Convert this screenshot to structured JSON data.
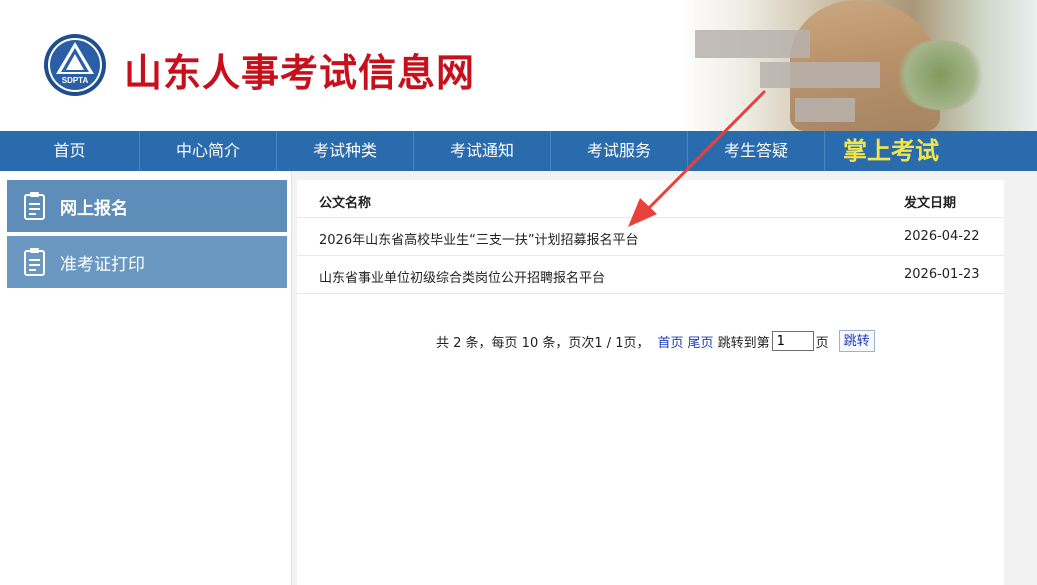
{
  "header": {
    "logo_text": "SDPTA",
    "site_title": "山东人事考试信息网"
  },
  "nav": {
    "items": [
      "首页",
      "中心简介",
      "考试种类",
      "考试通知",
      "考试服务",
      "考生答疑"
    ],
    "special": "掌上考试"
  },
  "sidebar": {
    "items": [
      {
        "label": "网上报名",
        "icon": "document-icon",
        "active": true
      },
      {
        "label": "准考证打印",
        "icon": "document-icon",
        "active": false
      }
    ]
  },
  "main": {
    "columns": {
      "name": "公文名称",
      "date": "发文日期"
    },
    "rows": [
      {
        "name": "2026年山东省高校毕业生“三支一扶”计划招募报名平台",
        "date": "2026-04-22"
      },
      {
        "name": "山东省事业单位初级综合类岗位公开招聘报名平台",
        "date": "2026-01-23"
      }
    ]
  },
  "pager": {
    "summary": "共 2 条，每页 10 条，页次1 / 1页，",
    "first": "首页",
    "last": "尾页",
    "jump_prefix": "跳转到第",
    "page_value": "1",
    "jump_suffix": "页",
    "go": "跳转"
  },
  "colors": {
    "nav_bg": "#2a6bad",
    "title_red": "#c8101c",
    "sidebar_item": "#6a98c1",
    "special_yellow": "#f3e44a",
    "arrow_red": "#e8413c"
  }
}
